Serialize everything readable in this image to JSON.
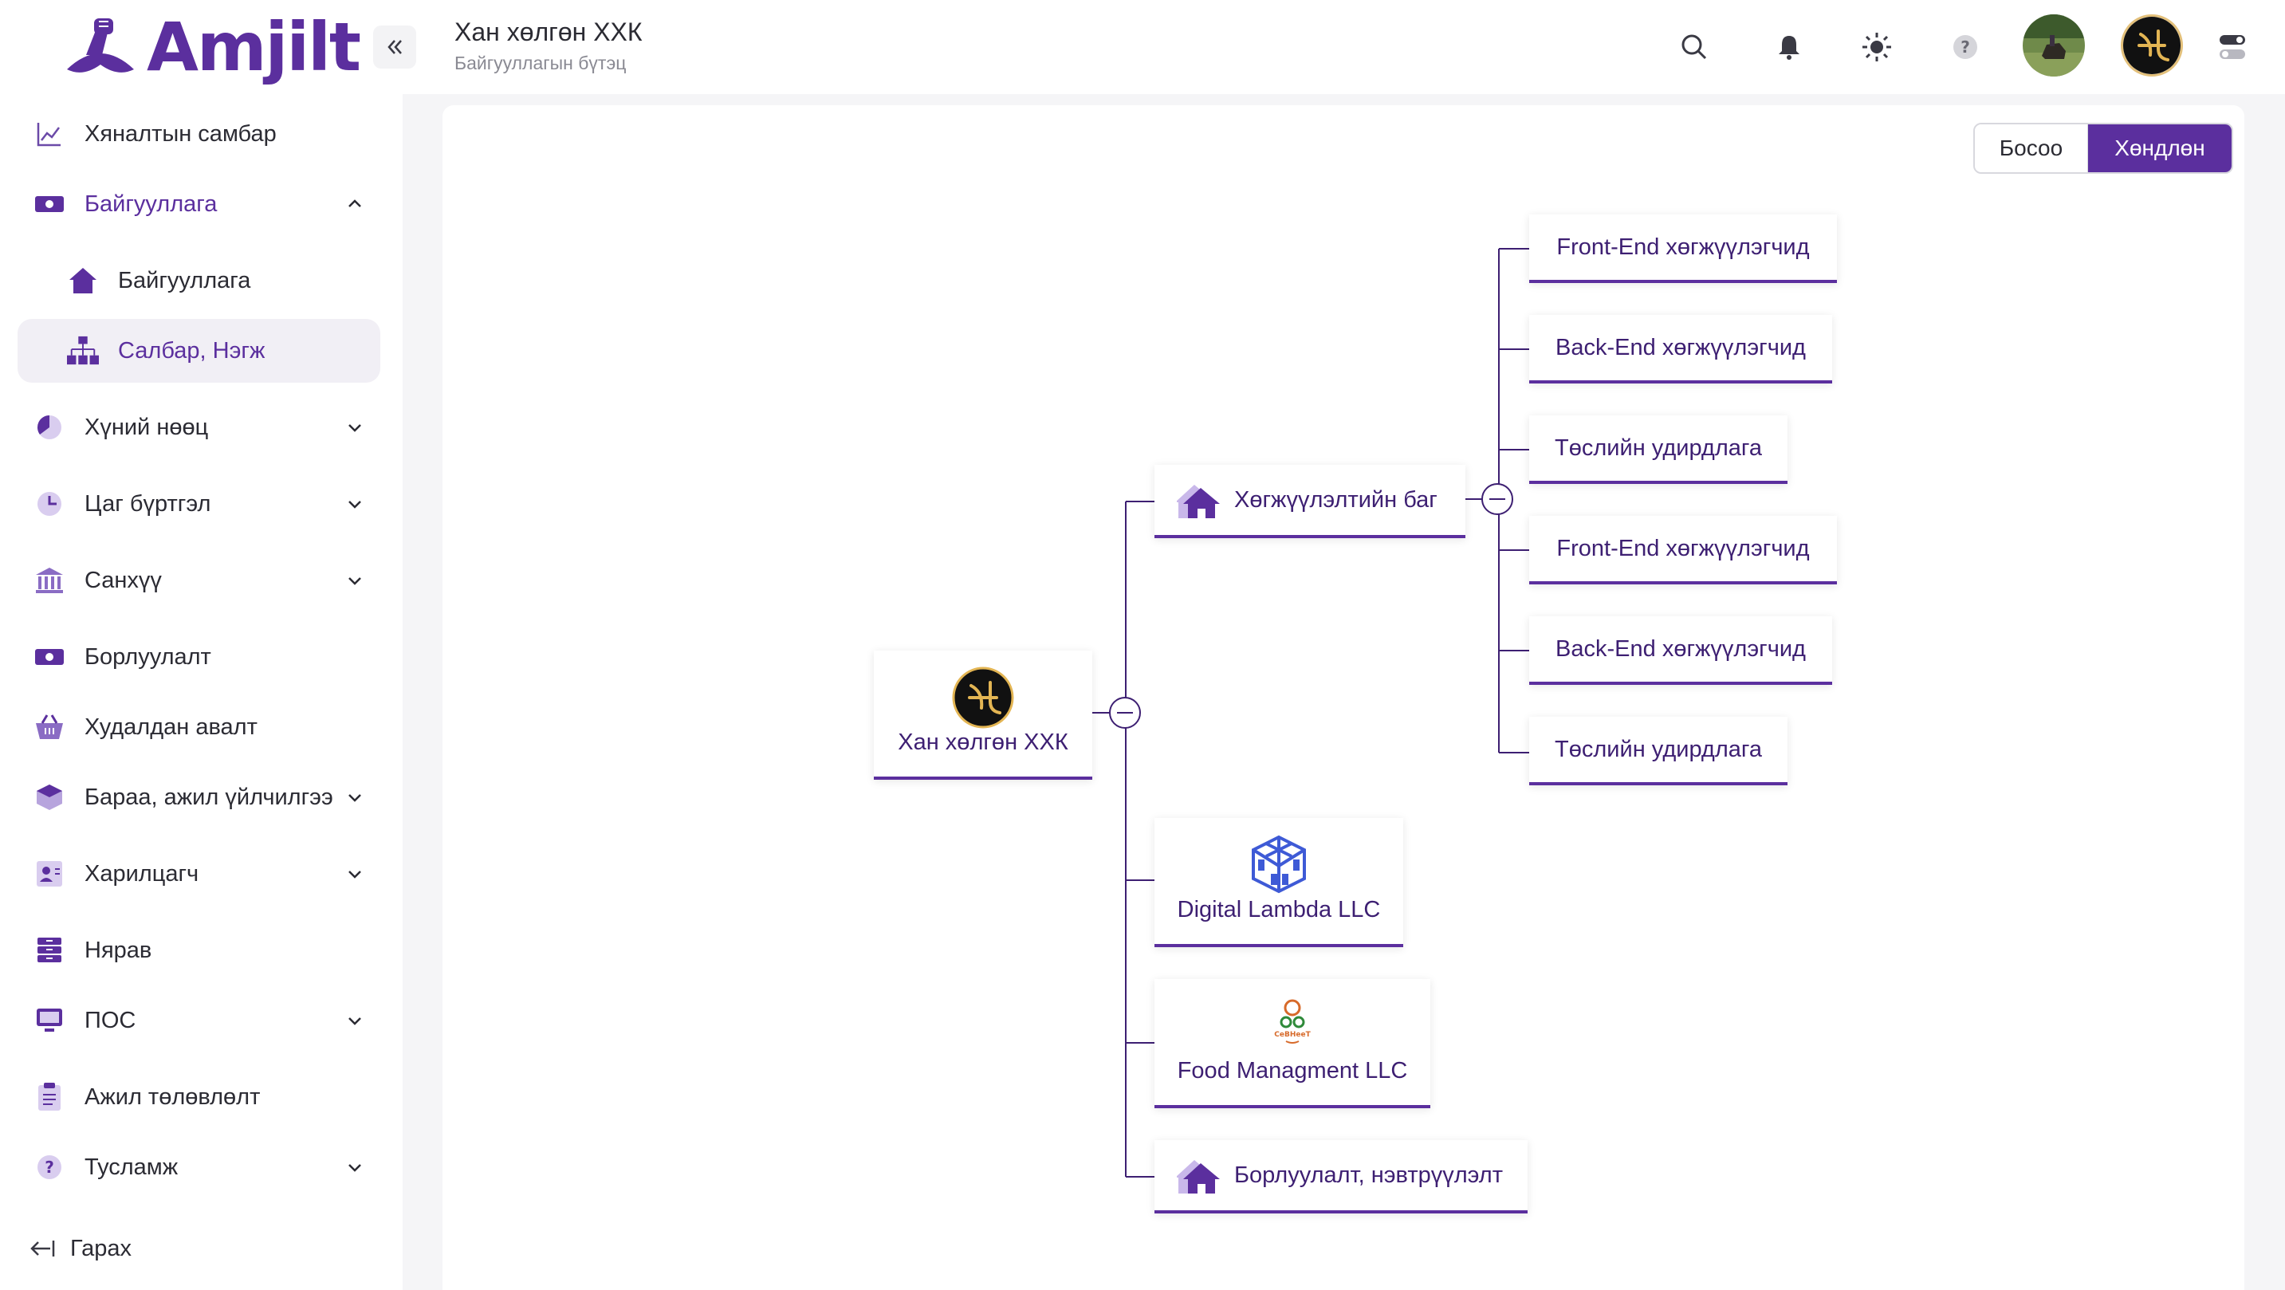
{
  "brand": {
    "name": "Amjilt"
  },
  "sidebar": {
    "items": [
      {
        "label": "Хяналтын самбар",
        "icon": "chart-line-icon"
      },
      {
        "label": "Байгууллага",
        "icon": "money-icon"
      },
      {
        "label": "Байгууллага",
        "icon": "home-icon"
      },
      {
        "label": "Салбар, Нэгж",
        "icon": "org-structure-icon"
      },
      {
        "label": "Хүний нөөц",
        "icon": "pie-icon"
      },
      {
        "label": "Цаг бүртгэл",
        "icon": "clock-icon"
      },
      {
        "label": "Санхүү",
        "icon": "bank-icon"
      },
      {
        "label": "Борлуулалт",
        "icon": "money-icon"
      },
      {
        "label": "Худалдан авалт",
        "icon": "basket-icon"
      },
      {
        "label": "Бараа, ажил үйлчилгээ",
        "icon": "box-icon"
      },
      {
        "label": "Харилцагч",
        "icon": "contact-card-icon"
      },
      {
        "label": "Нярав",
        "icon": "archive-icon"
      },
      {
        "label": "ПОС",
        "icon": "monitor-icon"
      },
      {
        "label": "Ажил төлөвлөлт",
        "icon": "clipboard-icon"
      },
      {
        "label": "Тусламж",
        "icon": "help-icon"
      }
    ],
    "logout": "Гарах"
  },
  "header": {
    "title": "Хан хөлгөн ХХК",
    "subtitle": "Байгууллагын бүтэц"
  },
  "view_toggle": {
    "vertical": "Босоо",
    "horizontal": "Хөндлөн",
    "active": "horizontal"
  },
  "org": {
    "root": "Хан хөлгөн ХХК",
    "dev_team": "Хөгжүүлэлтийн баг",
    "dev_children": [
      "Front-End хөгжүүлэгчид",
      "Back-End хөгжүүлэгчид",
      "Төслийн удирдлага",
      "Front-End хөгжүүлэгчид",
      "Back-End хөгжүүлэгчид",
      "Төслийн удирдлага"
    ],
    "digital": "Digital Lambda LLC",
    "food": "Food Managment LLC",
    "food_logo_text": "CeBHeeT",
    "sales": "Борлуулалт, нэвтрүүлэлт"
  },
  "colors": {
    "accent": "#5b2f9e",
    "node_text": "#3d1f72"
  }
}
